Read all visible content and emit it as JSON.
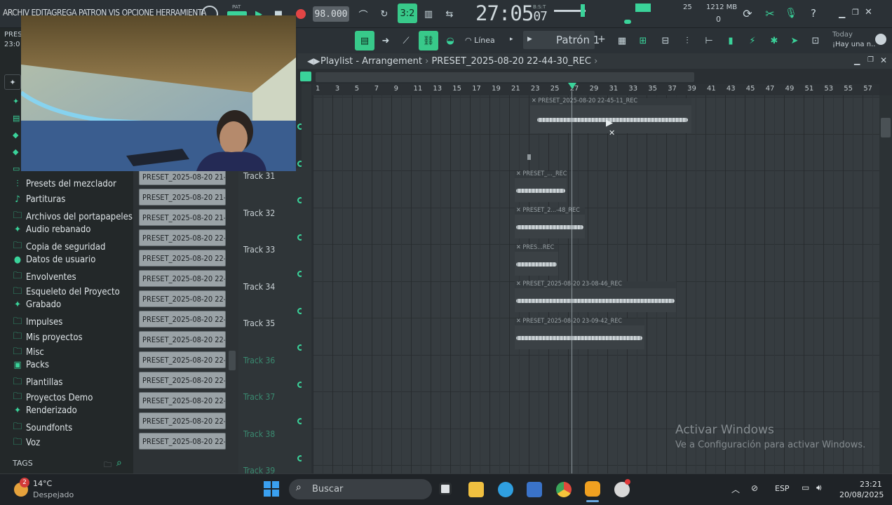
{
  "menu": "ARCHIV EDITAGREGA PATRON VIS OPCIONE HERRAMIENTA",
  "tempo": "98.000",
  "time": {
    "main": "27:05",
    "sub": "07",
    "label": "B:S:T"
  },
  "pat_label": "PAT",
  "cpu": {
    "value": "25",
    "mem": "1212 MB",
    "poly": "0"
  },
  "toolbar2": {
    "line_label": "Línea",
    "pattern_label": "Patrón 1",
    "news_title": "Today",
    "news_text": "¡Hay una n.."
  },
  "left_partial": {
    "a": "PRES",
    "b": "23:0"
  },
  "browser": [
    {
      "icon": "mixer-presets-icon",
      "glyph": "⫶",
      "label": "Presets del mezclador"
    },
    {
      "icon": "score-icon",
      "glyph": "♪",
      "label": "Partituras"
    },
    {
      "icon": "folder-icon",
      "glyph": "🗀",
      "label": "Archivos del portapapeles"
    },
    {
      "icon": "sliced-audio-icon",
      "glyph": "✦",
      "label": "Audio rebanado"
    },
    {
      "icon": "folder-icon",
      "glyph": "🗀",
      "label": "Copia de seguridad"
    },
    {
      "icon": "user-icon",
      "glyph": "●",
      "label": "Datos de usuario"
    },
    {
      "icon": "folder-icon",
      "glyph": "🗀",
      "label": "Envolventes"
    },
    {
      "icon": "folder-icon",
      "glyph": "🗀",
      "label": "Esqueleto del Proyecto"
    },
    {
      "icon": "recorded-icon",
      "glyph": "✦",
      "label": "Grabado"
    },
    {
      "icon": "folder-icon",
      "glyph": "🗀",
      "label": "Impulses"
    },
    {
      "icon": "folder-icon",
      "glyph": "🗀",
      "label": "Mis proyectos"
    },
    {
      "icon": "folder-icon",
      "glyph": "🗀",
      "label": "Misc"
    },
    {
      "icon": "packs-icon",
      "glyph": "▣",
      "label": "Packs"
    },
    {
      "icon": "folder-icon",
      "glyph": "🗀",
      "label": "Plantillas"
    },
    {
      "icon": "folder-icon",
      "glyph": "🗀",
      "label": "Proyectos Demo"
    },
    {
      "icon": "render-icon",
      "glyph": "✦",
      "label": "Renderizado"
    },
    {
      "icon": "folder-icon",
      "glyph": "🗀",
      "label": "Soundfonts"
    },
    {
      "icon": "folder-icon",
      "glyph": "🗀",
      "label": "Voz"
    }
  ],
  "tags_label": "TAGS",
  "patterns": [
    "PRESET_2025-08-20 21-...",
    "PRESET_2025-08-20 21-...",
    "PRESET_2025-08-20 21-...",
    "PRESET_2025-08-20 22-...",
    "PRESET_2025-08-20 22-...",
    "PRESET_2025-08-20 22-...",
    "PRESET_2025-08-20 22-...",
    "PRESET_2025-08-20 22-...",
    "PRESET_2025-08-20 22-...",
    "PRESET_2025-08-20 22-...",
    "PRESET_2025-08-20 22-...",
    "PRESET_2025-08-20 22-...",
    "PRESET_2025-08-20 22-...",
    "PRESET_2025-08-20 22-..."
  ],
  "tracks": [
    "Track 31",
    "Track 32",
    "Track 33",
    "Track 34",
    "Track 35",
    "Track 36",
    "Track 37",
    "Track 38",
    "Track 39"
  ],
  "playlist": {
    "title": "Playlist - Arrangement",
    "project": "PRESET_2025-08-20 22-44-30_REC"
  },
  "ruler": [
    "1",
    "3",
    "5",
    "7",
    "9",
    "11",
    "13",
    "15",
    "17",
    "19",
    "21",
    "23",
    "25",
    "27",
    "29",
    "31",
    "33",
    "35",
    "37",
    "39",
    "41",
    "43",
    "45",
    "47",
    "49",
    "51",
    "53",
    "55",
    "57"
  ],
  "clips": [
    "PRESET_2025-08-20 22-45-11_REC",
    "PRESET_..._REC",
    "PRESET_2...-48_REC",
    "PRES...REC",
    "PRESET_2025-08-20 23-08-46_REC",
    "PRESET_2025-08-20 23-09-42_REC"
  ],
  "watermark": {
    "title": "Activar Windows",
    "text": "Ve a Configuración para activar Windows."
  },
  "taskbar": {
    "weather_temp": "14°C",
    "weather_desc": "Despejado",
    "weather_badge": "2",
    "search": "Buscar",
    "lang": "ESP",
    "clock": "23:21",
    "date": "20/08/2025"
  }
}
